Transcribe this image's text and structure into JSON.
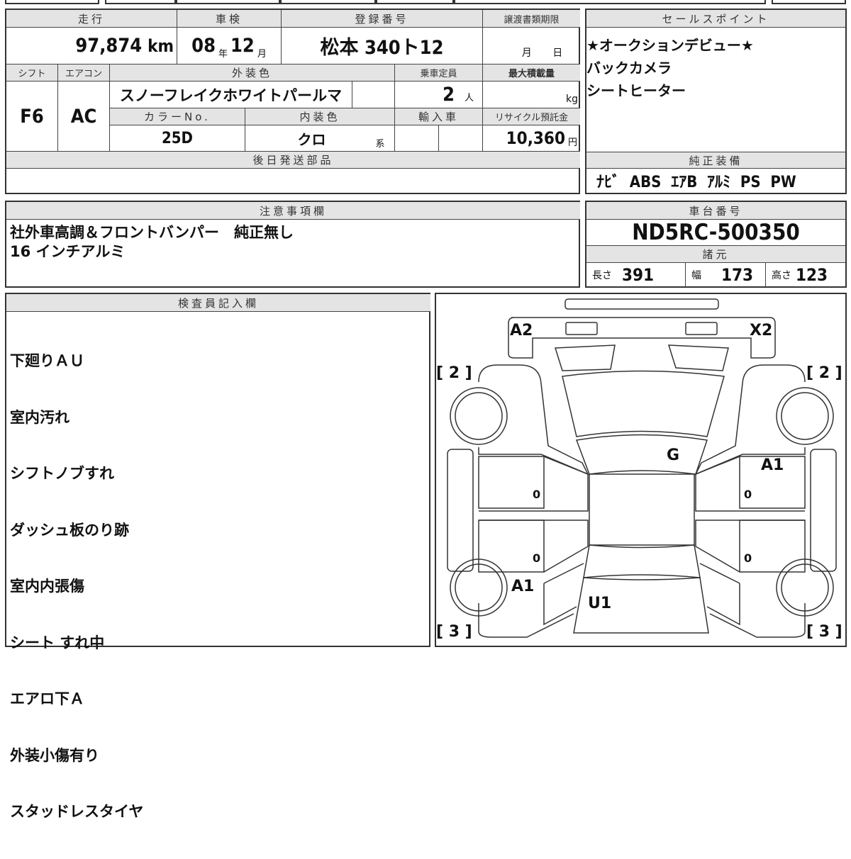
{
  "vehicle_info": {
    "mileage": {
      "label": "走行",
      "value": "97,874",
      "unit": "km"
    },
    "inspection": {
      "label": "車検",
      "year": "08",
      "year_unit": "年",
      "month": "12",
      "month_unit": "月"
    },
    "registration": {
      "label": "登録番号",
      "value": "松本 340ト12"
    },
    "transfer_deadline": {
      "label": "譲渡書類期限",
      "month_unit": "月",
      "day_unit": "日"
    },
    "shift": {
      "label": "シフト",
      "value": "F6"
    },
    "aircon": {
      "label": "エアコン",
      "value": "AC"
    },
    "exterior_color": {
      "label": "外装色",
      "value": "スノーフレイクホワイトパールマ"
    },
    "capacity": {
      "label": "乗車定員",
      "value": "2",
      "unit": "人"
    },
    "max_load": {
      "label": "最大積載量",
      "unit": "kg"
    },
    "color_no": {
      "label": "カラーNo.",
      "value": "25D"
    },
    "interior_color": {
      "label": "内装色",
      "value": "クロ",
      "unit": "系"
    },
    "imported": {
      "label": "輸入車"
    },
    "recycle_fee": {
      "label": "リサイクル預託金",
      "value": "10,360",
      "unit": "円"
    },
    "later_parts": {
      "label": "後日発送部品"
    }
  },
  "sales_points": {
    "label": "セールスポイント",
    "lines": [
      "★オークションデビュー★",
      "バックカメラ",
      "シートヒーター"
    ]
  },
  "standard_equipment": {
    "label": "純正装備",
    "value": "ﾅﾋﾞ  ABS  ｴｱB  ｱﾙﾐ  PS  PW"
  },
  "notes": {
    "label": "注意事項欄",
    "lines": [
      "社外車高調＆フロントバンパー　純正無し",
      "16 インチアルミ"
    ]
  },
  "chassis": {
    "label": "車台番号",
    "value": "ND5RC-500350"
  },
  "specs": {
    "label": "諸元",
    "length_label": "長さ",
    "length": "391",
    "width_label": "幅",
    "width": "173",
    "height_label": "高さ",
    "height": "123"
  },
  "inspector": {
    "label": "検査員記入欄",
    "lines": [
      "下廻りＡＵ",
      "室内汚れ",
      "シフトノブすれ",
      "ダッシュ板のり跡",
      "室内内張傷",
      "シート すれ中",
      "エアロ下Ａ",
      "外装小傷有り",
      "スタッドレスタイヤ"
    ]
  },
  "diagram": {
    "marks": {
      "front_left": "A2",
      "front_right": "X2",
      "front_left_tire": "[ 2 ]",
      "front_right_tire": "[ 2 ]",
      "roof": "G",
      "right_door": "A1",
      "rear_left_door": "A1",
      "trunk": "U1",
      "rear_left_tire": "[ 3 ]",
      "rear_right_tire": "[ 3 ]",
      "zero": "0"
    }
  }
}
